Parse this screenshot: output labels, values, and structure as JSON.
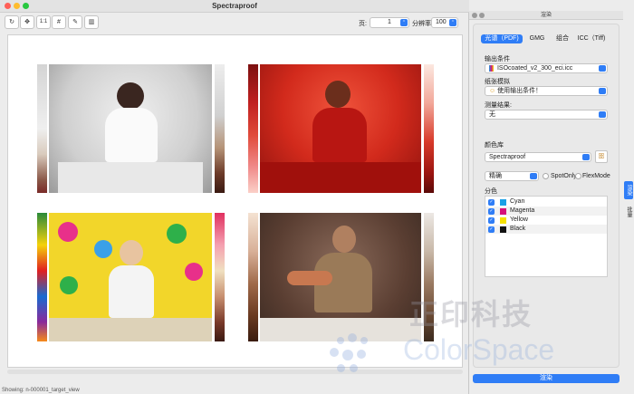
{
  "window": {
    "title": "Spectraproof"
  },
  "toolbar": {
    "buttons": [
      {
        "name": "rotate-icon",
        "glyph": "↻"
      },
      {
        "name": "move-icon",
        "glyph": "✥"
      },
      {
        "name": "actual-size-button",
        "glyph": "1:1"
      },
      {
        "name": "grid-icon",
        "glyph": "#"
      },
      {
        "name": "eyedropper-icon",
        "glyph": "✎"
      },
      {
        "name": "compare-icon",
        "glyph": "▥"
      }
    ],
    "page_label": "页:",
    "page_value": "1",
    "resolution_label": "分辨率",
    "resolution_value": "100"
  },
  "status": {
    "text": "Showing: n-000001_target_view"
  },
  "panel": {
    "title": "渲染",
    "tabs": [
      "光谱（PDF)",
      "GMG",
      "组合",
      "ICC（Tiff)"
    ],
    "output_condition_label": "输出条件",
    "output_condition_value": "ISOcoated_v2_300_eci.icc",
    "paper_sim_label": "纸张模拟",
    "paper_sim_value": "使用输出条件！",
    "measure_label": "测量结果:",
    "measure_value": "无",
    "color_lib_label": "颜色库",
    "color_lib_value": "Spectraproof",
    "precision_value": "精确",
    "spot_only_label": "SpotOnly",
    "flexmode_label": "FlexMode",
    "separations_label": "分色",
    "separations": [
      {
        "name": "Cyan",
        "color": "#1aa0e6"
      },
      {
        "name": "Magenta",
        "color": "#d6107a"
      },
      {
        "name": "Yellow",
        "color": "#f5e100"
      },
      {
        "name": "Black",
        "color": "#111111"
      }
    ],
    "render_button": "渲染",
    "side_tabs": [
      "渲染",
      "批量"
    ]
  },
  "watermark": {
    "cn": "正印科技",
    "en": "ColorSpace"
  }
}
